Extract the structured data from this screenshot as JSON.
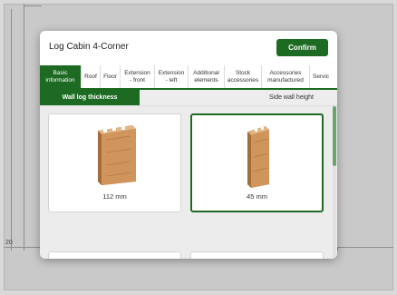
{
  "modal": {
    "title": "Log Cabin 4-Corner",
    "confirm_label": "Confirm"
  },
  "background": {
    "dimension_label": "20"
  },
  "tabs": [
    {
      "label": "Basic\ninformation",
      "active": true
    },
    {
      "label": "Roof",
      "active": false
    },
    {
      "label": "Floor",
      "active": false
    },
    {
      "label": "Extension\n- front",
      "active": false
    },
    {
      "label": "Extension\n- left",
      "active": false
    },
    {
      "label": "Additional\nelements",
      "active": false
    },
    {
      "label": "Stock\naccessories",
      "active": false
    },
    {
      "label": "Accessories\nmanufactured",
      "active": false
    },
    {
      "label": "Servic",
      "active": false
    }
  ],
  "subtabs": [
    {
      "label": "Wall log thickness",
      "active": true
    },
    {
      "label": "Side wall height",
      "active": false
    }
  ],
  "options": [
    {
      "label": "112 mm",
      "selected": false,
      "icon": "wall-log-icon"
    },
    {
      "label": "45 mm",
      "selected": true,
      "icon": "wall-log-icon"
    },
    {
      "label": "",
      "selected": false,
      "icon": "wall-log-icon"
    },
    {
      "label": "",
      "selected": false,
      "icon": "wall-log-icon"
    }
  ],
  "colors": {
    "accent": "#1d6a23",
    "wood": "#c98f55",
    "wood_dark": "#9c6a3a"
  }
}
